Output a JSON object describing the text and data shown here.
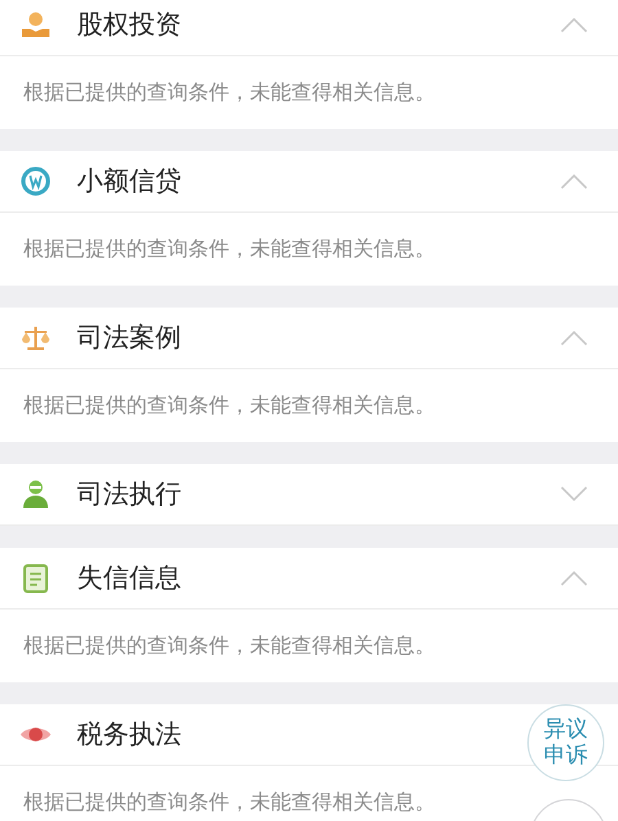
{
  "sections": [
    {
      "title": "股权投资",
      "expanded": true,
      "message": "根据已提供的查询条件，未能查得相关信息。"
    },
    {
      "title": "小额信贷",
      "expanded": true,
      "message": "根据已提供的查询条件，未能查得相关信息。"
    },
    {
      "title": "司法案例",
      "expanded": true,
      "message": "根据已提供的查询条件，未能查得相关信息。"
    },
    {
      "title": "司法执行",
      "expanded": false
    },
    {
      "title": "失信信息",
      "expanded": true,
      "message": "根据已提供的查询条件，未能查得相关信息。"
    },
    {
      "title": "税务执法",
      "expanded": true,
      "chevron_covered": true,
      "message": "根据已提供的查询条件，未能查得相关信息。"
    }
  ],
  "objection_button": {
    "label": "异议申诉"
  }
}
